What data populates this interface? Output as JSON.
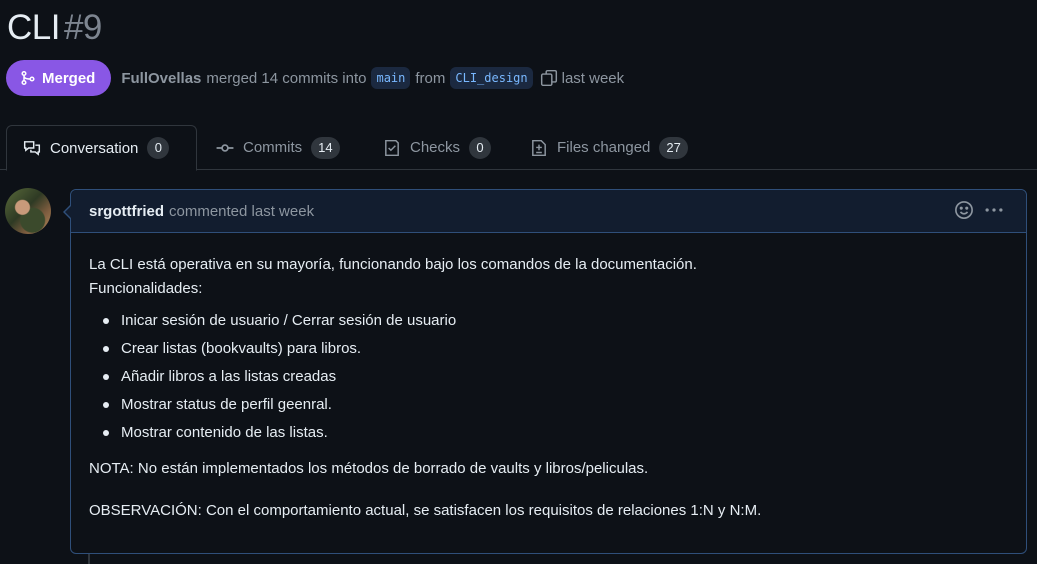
{
  "pr": {
    "title": "CLI",
    "number": "#9",
    "status": "Merged",
    "author": "FullOvellas",
    "merge_text": "merged 14 commits into",
    "base_branch": "main",
    "from_text": "from",
    "head_branch": "CLI_design",
    "time": "last week"
  },
  "tabs": [
    {
      "label": "Conversation",
      "count": "0",
      "icon": "conversation-icon"
    },
    {
      "label": "Commits",
      "count": "14",
      "icon": "commit-icon"
    },
    {
      "label": "Checks",
      "count": "0",
      "icon": "checks-icon"
    },
    {
      "label": "Files changed",
      "count": "27",
      "icon": "file-diff-icon"
    }
  ],
  "comment": {
    "user": "srgottfried",
    "action": "commented last week",
    "intro_line1": "La CLI está operativa en su mayoría, funcionando bajo los comandos de la documentación.",
    "intro_line2": "Funcionalidades:",
    "items": [
      "Inicar sesión de usuario / Cerrar sesión de usuario",
      "Crear listas (bookvaults) para libros.",
      "Añadir libros a las listas creadas",
      "Mostrar status de perfil geenral.",
      "Mostrar contenido de las listas."
    ],
    "note": "NOTA: No están implementados los métodos de borrado de vaults y libros/peliculas.",
    "observation": "OBSERVACIÓN: Con el comportamiento actual, se satisfacen los requisitos de relaciones 1:N y N:M."
  },
  "colors": {
    "background": "#0d1117",
    "merged": "#8957e5",
    "branch_bg": "#1b2940",
    "branch_text": "#79b8ff",
    "comment_border": "#2f4f7a"
  }
}
